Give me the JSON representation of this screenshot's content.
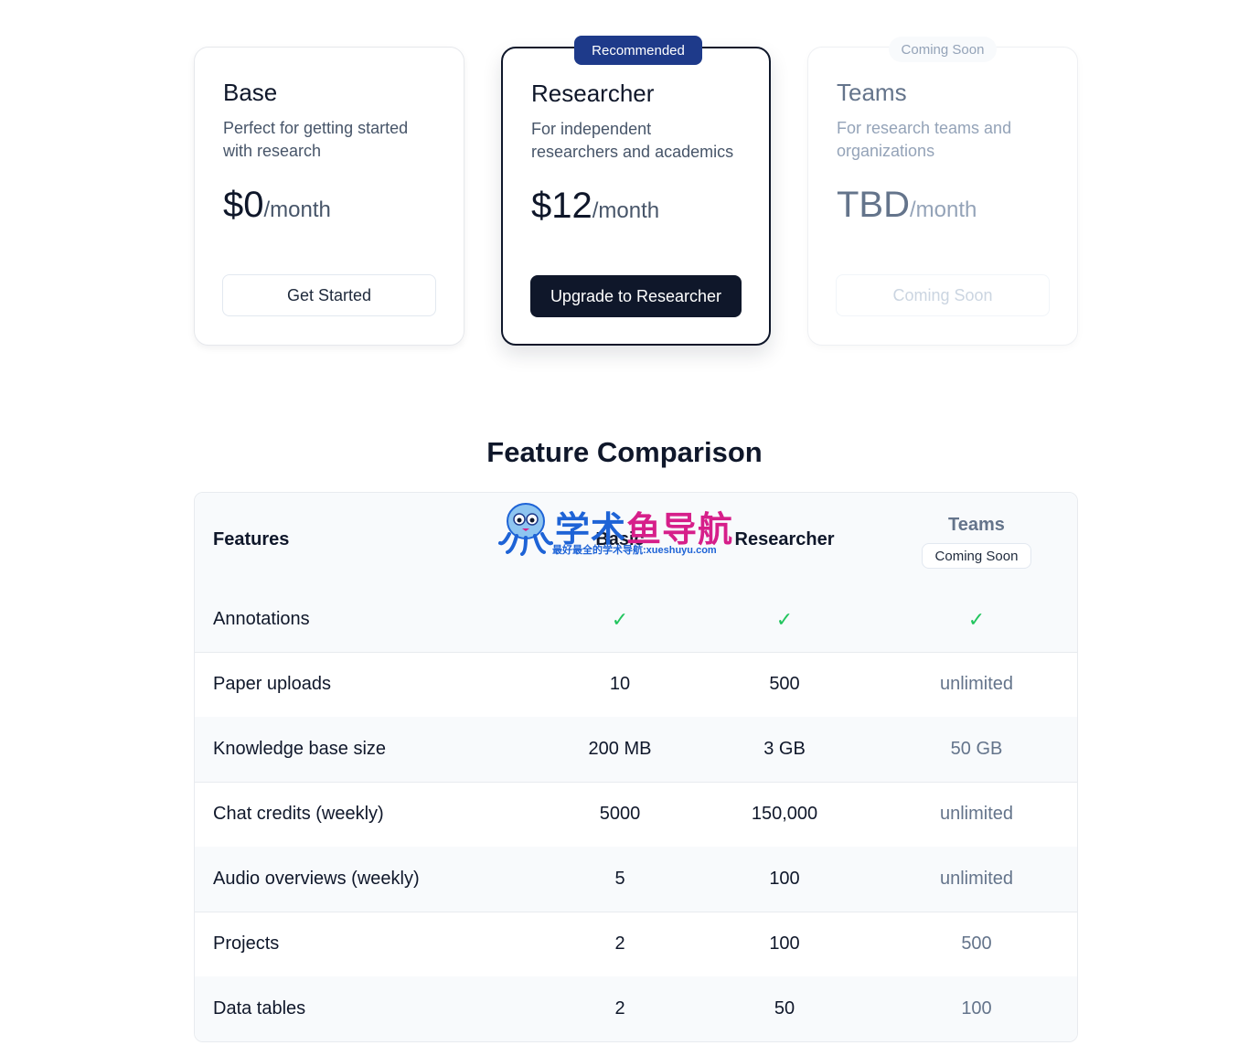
{
  "plans": [
    {
      "name": "Base",
      "description": "Perfect for getting started with research",
      "price": "$0",
      "period": "/month",
      "button": "Get Started"
    },
    {
      "name": "Researcher",
      "badge": "Recommended",
      "description": "For independent researchers and academics",
      "price": "$12",
      "period": "/month",
      "button": "Upgrade to Researcher"
    },
    {
      "name": "Teams",
      "badge": "Coming Soon",
      "description": "For research teams and organizations",
      "price": "TBD",
      "period": "/month",
      "button": "Coming Soon"
    }
  ],
  "comparison": {
    "title": "Feature Comparison",
    "headers": {
      "features": "Features",
      "basic": "Basic",
      "researcher": "Researcher",
      "teams": "Teams",
      "teams_badge": "Coming Soon"
    },
    "check_icon": "✓",
    "rows": [
      {
        "feature": "Annotations",
        "basic": "✓",
        "researcher": "✓",
        "teams": "✓"
      },
      {
        "feature": "Paper uploads",
        "basic": "10",
        "researcher": "500",
        "teams": "unlimited"
      },
      {
        "feature": "Knowledge base size",
        "basic": "200 MB",
        "researcher": "3 GB",
        "teams": "50 GB"
      },
      {
        "feature": "Chat credits (weekly)",
        "basic": "5000",
        "researcher": "150,000",
        "teams": "unlimited"
      },
      {
        "feature": "Audio overviews (weekly)",
        "basic": "5",
        "researcher": "100",
        "teams": "unlimited"
      },
      {
        "feature": "Projects",
        "basic": "2",
        "researcher": "100",
        "teams": "500"
      },
      {
        "feature": "Data tables",
        "basic": "2",
        "researcher": "50",
        "teams": "100"
      }
    ]
  },
  "watermark": {
    "title_part1": "学术",
    "title_part2": "鱼导航",
    "subtitle_part1": "最好最全的学术导航:",
    "subtitle_part2": "xueshuyu.com"
  },
  "colors": {
    "primary_dark": "#0f172a",
    "recommended_badge": "#1e3a8a",
    "check": "#22c55e",
    "muted": "#64748b"
  }
}
